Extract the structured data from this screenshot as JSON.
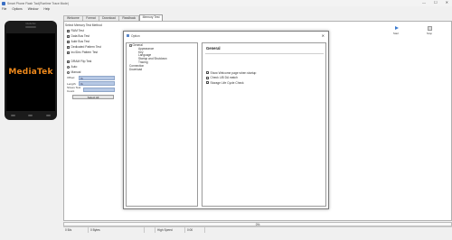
{
  "window": {
    "title": "Smart Phone Flash Tool(Runtime Trace Mode)",
    "controls": [
      "—",
      "☐",
      "✕"
    ]
  },
  "menu": [
    "File",
    "Options",
    "Window",
    "Help"
  ],
  "device": {
    "brand": "MediaTek",
    "logo_text": "MediaTek",
    "logo_color": "#f08a1c"
  },
  "tabs": [
    {
      "label": "Welcome",
      "active": false
    },
    {
      "label": "Format",
      "active": false
    },
    {
      "label": "Download",
      "active": false
    },
    {
      "label": "Readback",
      "active": false
    },
    {
      "label": "Memory Test",
      "active": true
    }
  ],
  "memory_test": {
    "group_title": "Select Memory Test Method",
    "checks": [
      {
        "label": "RAM Test",
        "checked": true
      },
      {
        "label": "Data Bus Test",
        "checked": true
      },
      {
        "label": "Addr Bus Test",
        "checked": true
      },
      {
        "label": "Dedicated Pattern Test",
        "checked": true
      },
      {
        "label": "Inc/Dec Pattern Test",
        "checked": true
      }
    ],
    "dram_flip": {
      "label": "DRAM Flip Test",
      "checked": true
    },
    "mode_auto": {
      "label": "Auto",
      "selected": true
    },
    "mode_manual": {
      "label": "Manual",
      "selected": false
    },
    "offset_label": "Offset:",
    "offset_value": "0x",
    "length_label": "Length:",
    "length_value": "0x",
    "stress_label": "Stress Test Count",
    "stress_value": "",
    "select_all": "Select All"
  },
  "toolbar": {
    "start_label": "Start",
    "stop_label": "Stop"
  },
  "dialog": {
    "title": "Option",
    "close": "✕",
    "tree": [
      {
        "label": "General",
        "level": 1,
        "expander": "−"
      },
      {
        "label": "Appearance",
        "level": 2
      },
      {
        "label": "Key",
        "level": 2
      },
      {
        "label": "Language",
        "level": 2
      },
      {
        "label": "Startup and Shutdown",
        "level": 2
      },
      {
        "label": "Tracing",
        "level": 2
      },
      {
        "label": "Connection",
        "level": 1
      },
      {
        "label": "Download",
        "level": 1
      }
    ],
    "pane_title": "General",
    "options": [
      {
        "label": "Show Welcome page when startup",
        "checked": true
      },
      {
        "label": "Check LIB DA match",
        "checked": true
      },
      {
        "label": "Storage Life Cycle Check",
        "checked": true
      }
    ]
  },
  "progress": {
    "percent_text": "0%",
    "value": 0
  },
  "status": [
    "0 B/s",
    "0 Bytes",
    "",
    "High Speed",
    "0:00"
  ]
}
